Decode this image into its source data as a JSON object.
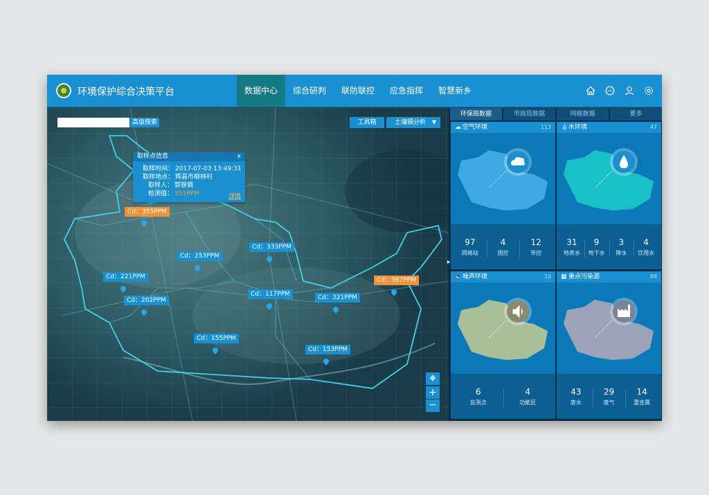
{
  "app": {
    "title": "环境保护综合决策平台"
  },
  "nav": [
    {
      "label": "数据中心",
      "active": true
    },
    {
      "label": "综合研判",
      "active": false
    },
    {
      "label": "联防联控",
      "active": false
    },
    {
      "label": "应急指挥",
      "active": false
    },
    {
      "label": "智慧新乡",
      "active": false
    }
  ],
  "top_icons": [
    "home-icon",
    "message-icon",
    "user-icon",
    "settings-icon"
  ],
  "map": {
    "search": {
      "value": "",
      "placeholder": "",
      "button": "高级搜索"
    },
    "toolbox_label": "工具箱",
    "analysis_label": "土壤镉分析",
    "popup": {
      "title": "取样点信息",
      "close": "x",
      "rows": [
        {
          "label": "取样时间：",
          "value": "2017-07-03  13:49:31"
        },
        {
          "label": "取样地点：",
          "value": "辉县市柳林村"
        },
        {
          "label": "取样人：",
          "value": "郭铁钢"
        },
        {
          "label": "检测值：",
          "value": "355PPM"
        }
      ],
      "detail": "详情"
    },
    "markers": [
      {
        "label": "Cd：355PPM",
        "color": "orange"
      },
      {
        "label": "Cd：333PPM",
        "color": "blue"
      },
      {
        "label": "Cd：253PPM",
        "color": "blue"
      },
      {
        "label": "Cd：221PPM",
        "color": "blue"
      },
      {
        "label": "Cd：202PPM",
        "color": "blue"
      },
      {
        "label": "Cd：117PPM",
        "color": "blue"
      },
      {
        "label": "Cd：321PPM",
        "color": "blue"
      },
      {
        "label": "Cd：367PPM",
        "color": "orange"
      },
      {
        "label": "Cd：155PPM",
        "color": "blue"
      },
      {
        "label": "Cd：153PPM",
        "color": "blue"
      }
    ],
    "controls": {
      "pan": "✥",
      "zoom_in": "+",
      "zoom_out": "−"
    }
  },
  "panel": {
    "tabs": [
      {
        "label": "环保局数据",
        "active": true
      },
      {
        "label": "市政局数据",
        "active": false
      },
      {
        "label": "网格数据",
        "active": false
      },
      {
        "label": "更多",
        "active": false
      }
    ],
    "cards": [
      {
        "title": "空气环境",
        "count": "113",
        "icon": "cloud-icon",
        "color": "#3fa9e2",
        "stats": [
          {
            "value": "97",
            "label": "网格站"
          },
          {
            "value": "4",
            "label": "国控"
          },
          {
            "value": "12",
            "label": "市控"
          }
        ]
      },
      {
        "title": "水环境",
        "count": "47",
        "icon": "water-drop-icon",
        "color": "#18c0c8",
        "stats": [
          {
            "value": "31",
            "label": "地表水"
          },
          {
            "value": "9",
            "label": "地下水"
          },
          {
            "value": "3",
            "label": "降水"
          },
          {
            "value": "4",
            "label": "饮用水"
          }
        ]
      },
      {
        "title": "噪声环境",
        "count": "10",
        "icon": "speaker-icon",
        "color": "#a9bf9a",
        "stats": [
          {
            "value": "6",
            "label": "监测点"
          },
          {
            "value": "4",
            "label": "功能区"
          }
        ]
      },
      {
        "title": "重点污染源",
        "count": "86",
        "icon": "factory-icon",
        "color": "#9aa3b8",
        "stats": [
          {
            "value": "43",
            "label": "废水"
          },
          {
            "value": "29",
            "label": "废气"
          },
          {
            "value": "14",
            "label": "重金属"
          }
        ]
      }
    ]
  }
}
